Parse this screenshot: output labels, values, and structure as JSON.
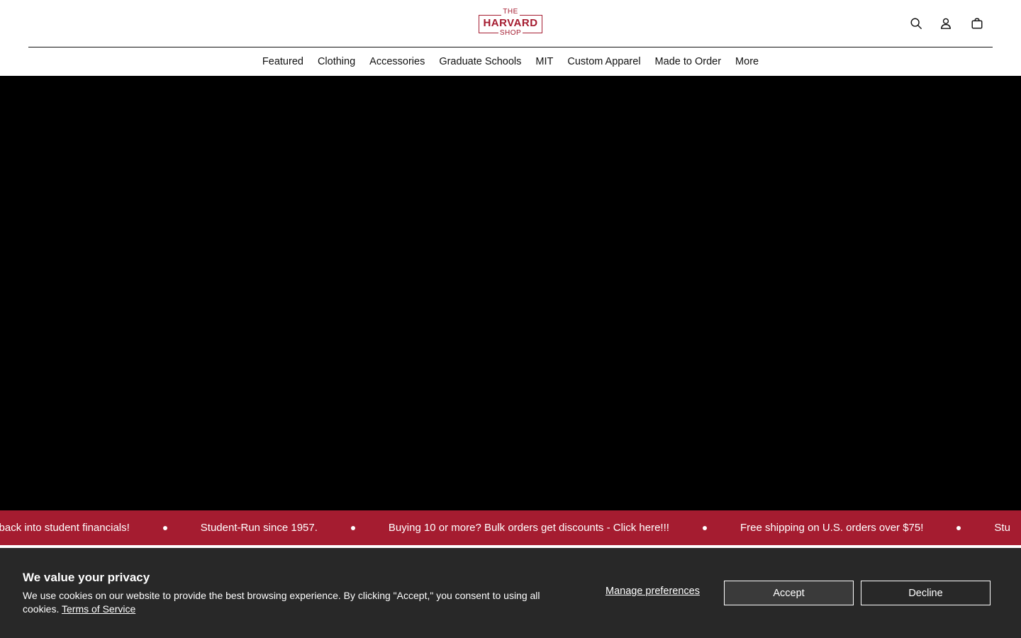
{
  "logo": {
    "line1": "THE",
    "line2": "HARVARD",
    "line3": "SHOP",
    "brand_color": "#a51c30"
  },
  "header_icons": [
    "search-icon",
    "account-icon",
    "cart-icon"
  ],
  "nav": {
    "items": [
      {
        "label": "Featured"
      },
      {
        "label": "Clothing"
      },
      {
        "label": "Accessories"
      },
      {
        "label": "Graduate Schools"
      },
      {
        "label": "MIT"
      },
      {
        "label": "Custom Apparel"
      },
      {
        "label": "Made to Order"
      },
      {
        "label": "More"
      }
    ]
  },
  "hero": {
    "background": "#000000"
  },
  "ticker": {
    "background": "#a51c30",
    "messages": [
      "o back into student financials!",
      "Student-Run since 1957.",
      "Buying 10 or more? Bulk orders get discounts - Click here!!!",
      "Free shipping on U.S. orders over $75!",
      "Stu"
    ]
  },
  "cookie": {
    "title": "We value your privacy",
    "text": "We use cookies on our website to provide the best browsing experience. By clicking \"Accept,\" you consent to using all cookies.",
    "terms_link": "Terms of Service",
    "manage_label": "Manage preferences",
    "accept_label": "Accept",
    "decline_label": "Decline",
    "background": "#282828"
  }
}
